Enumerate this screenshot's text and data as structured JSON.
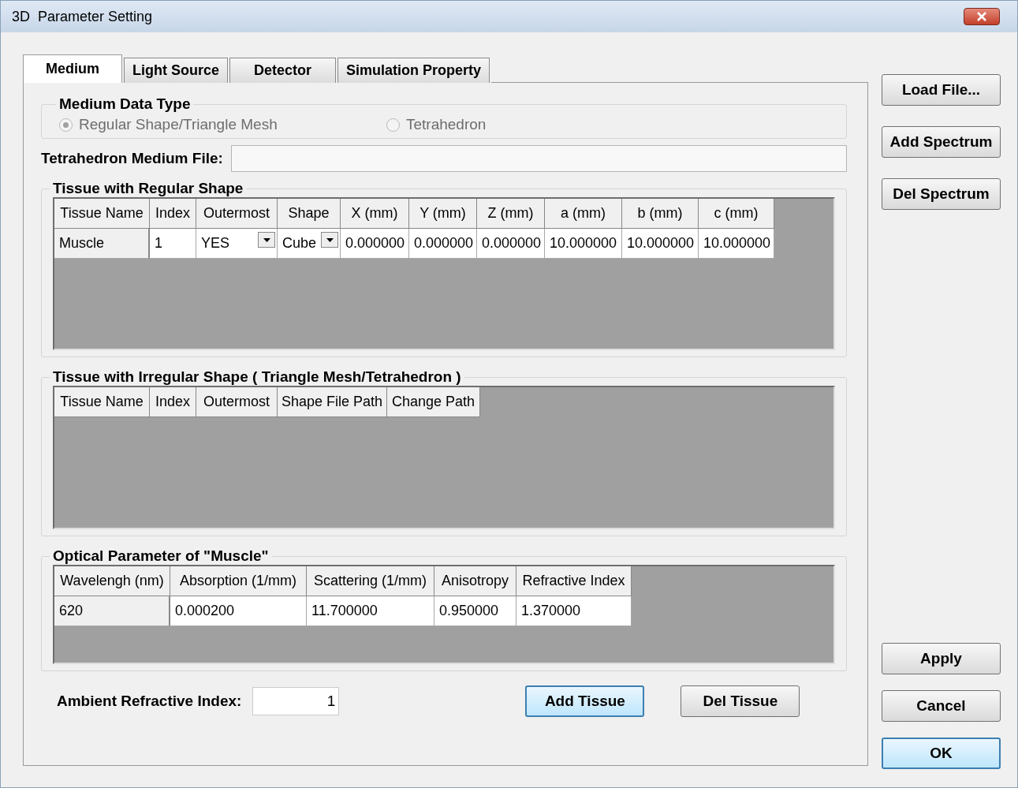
{
  "window": {
    "title": "3D  Parameter Setting"
  },
  "tabs": [
    {
      "label": "Medium",
      "selected": true
    },
    {
      "label": "Light Source",
      "selected": false
    },
    {
      "label": "Detector",
      "selected": false
    },
    {
      "label": "Simulation Property",
      "selected": false
    }
  ],
  "medium_data_type": {
    "title": "Medium Data Type",
    "options": [
      {
        "label": "Regular Shape/Triangle Mesh",
        "selected": true,
        "disabled": true
      },
      {
        "label": "Tetrahedron",
        "selected": false,
        "disabled": true
      }
    ]
  },
  "tetrahedron_file": {
    "label": "Tetrahedron Medium File:"
  },
  "regular_tissue": {
    "title": "Tissue with Regular Shape",
    "columns": [
      {
        "label": "Tissue Name",
        "kind": "text"
      },
      {
        "label": "Index",
        "kind": "text"
      },
      {
        "label": "Outermost",
        "kind": "dropdown"
      },
      {
        "label": "Shape",
        "kind": "dropdown"
      },
      {
        "label": "X (mm)",
        "kind": "text"
      },
      {
        "label": "Y (mm)",
        "kind": "text"
      },
      {
        "label": "Z (mm)",
        "kind": "text"
      },
      {
        "label": "a (mm)",
        "kind": "text"
      },
      {
        "label": "b (mm)",
        "kind": "text"
      },
      {
        "label": "c (mm)",
        "kind": "text"
      }
    ],
    "rows": [
      [
        "Muscle",
        "1",
        "YES",
        "Cube",
        "0.000000",
        "0.000000",
        "0.000000",
        "10.000000",
        "10.000000",
        "10.000000"
      ]
    ]
  },
  "irregular_tissue": {
    "title": "Tissue with Irregular Shape ( Triangle Mesh/Tetrahedron )",
    "columns": [
      {
        "label": "Tissue Name"
      },
      {
        "label": "Index"
      },
      {
        "label": "Outermost"
      },
      {
        "label": "Shape File Path"
      },
      {
        "label": "Change Path"
      }
    ]
  },
  "optical": {
    "title": "Optical Parameter of \"Muscle\"",
    "columns": [
      {
        "label": "Wavelengh (nm)"
      },
      {
        "label": "Absorption (1/mm)"
      },
      {
        "label": "Scattering (1/mm)"
      },
      {
        "label": "Anisotropy"
      },
      {
        "label": "Refractive Index"
      }
    ],
    "rows": [
      [
        "620",
        "0.000200",
        "11.700000",
        "0.950000",
        "1.370000"
      ]
    ]
  },
  "ambient": {
    "label": "Ambient Refractive Index:",
    "value": "1"
  },
  "bottom_buttons": [
    {
      "label": "Add Tissue",
      "default": true
    },
    {
      "label": "Del Tissue",
      "default": false
    }
  ],
  "side_top_buttons": [
    {
      "label": "Load File...",
      "default": false
    },
    {
      "label": "Add Spectrum",
      "default": false
    },
    {
      "label": "Del Spectrum",
      "default": false
    }
  ],
  "side_bottom_buttons": [
    {
      "label": "Apply",
      "default": false
    },
    {
      "label": "Cancel",
      "default": false
    },
    {
      "label": "OK",
      "default": true
    }
  ]
}
